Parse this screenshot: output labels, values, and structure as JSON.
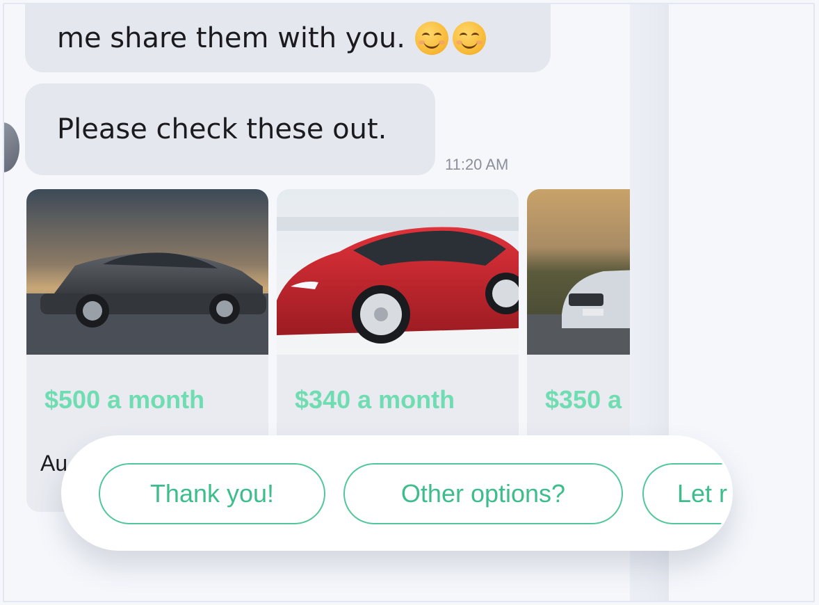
{
  "chat": {
    "messages": [
      {
        "text": "me share them with you.",
        "emojis": [
          "smiling-face-icon",
          "smiling-face-icon"
        ]
      },
      {
        "text": "Please check these out.",
        "time": "11:20 AM"
      }
    ]
  },
  "cards": [
    {
      "image": "dark-gray-sedan-photo",
      "price": "$500 a month",
      "title": "Au"
    },
    {
      "image": "red-sedan-photo",
      "price": "$340 a month",
      "title": ""
    },
    {
      "image": "silver-suv-photo",
      "price": "$350 a",
      "title": ""
    }
  ],
  "quick_replies": [
    "Thank you!",
    "Other options?",
    "Let r"
  ],
  "colors": {
    "accent": "#3cbd8b",
    "bubble": "#e5e7ef",
    "background": "#f5f7fb",
    "price": "#6fdcb1"
  }
}
